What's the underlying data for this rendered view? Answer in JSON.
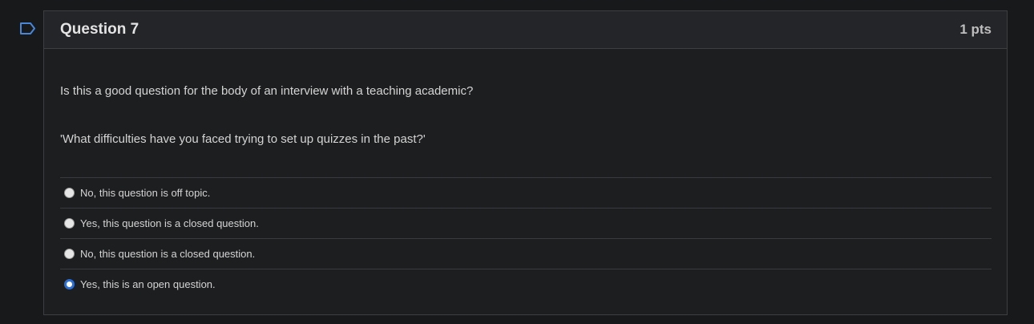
{
  "flag": {
    "icon": "bookmark-flag-icon"
  },
  "question": {
    "title": "Question 7",
    "points": "1 pts",
    "text_line1": "Is this a good question for the body of an interview with a teaching academic?",
    "text_line2": "'What difficulties have you faced trying to set up quizzes in the past?'",
    "answers": [
      {
        "label": "No, this question is off topic.",
        "selected": false
      },
      {
        "label": "Yes, this question is a closed question.",
        "selected": false
      },
      {
        "label": "No, this question is a closed question.",
        "selected": false
      },
      {
        "label": "Yes, this is an open question.",
        "selected": true
      }
    ]
  },
  "colors": {
    "background": "#18191b",
    "panel": "#1d1e20",
    "header": "#242528",
    "border": "#3c3e41",
    "radio_selected": "#2b6fd4"
  }
}
